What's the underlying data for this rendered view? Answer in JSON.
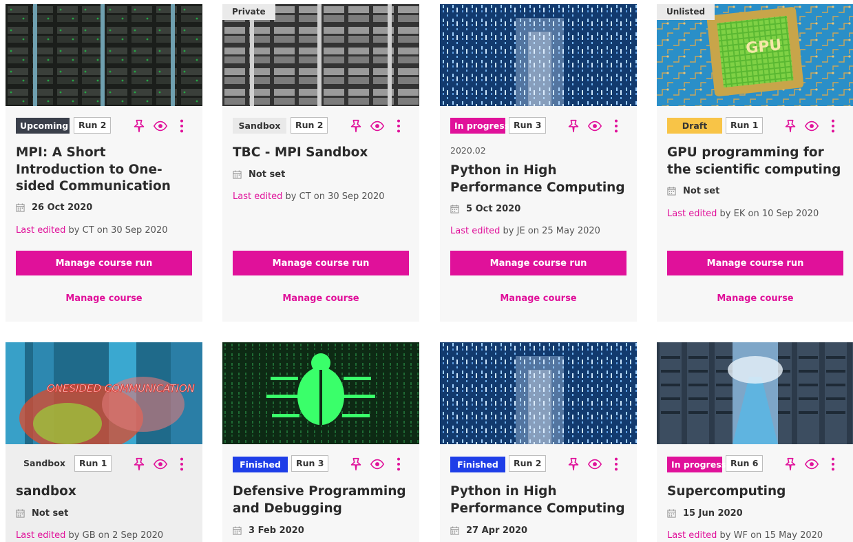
{
  "colors": {
    "accent": "#e0119a",
    "upcoming": "#3a3f4a",
    "draft": "#f8c447",
    "finished": "#1e3ee8",
    "sandbox": "#e9e9e9"
  },
  "icons": {
    "pin": "pin-icon",
    "preview": "eye-icon",
    "more": "more-vertical-icon",
    "date": "calendar-icon"
  },
  "actions": {
    "manage_run": "Manage course run",
    "manage_course": "Manage course"
  },
  "cards": [
    {
      "visibility": "",
      "status": "Upcoming",
      "run": "Run 2",
      "code": "",
      "title": "MPI: A Short Introduction to One-sided Communication",
      "date": "26 Oct 2020",
      "edited_link": "Last edited",
      "edited_rest": " by CT on 30 Sep 2020"
    },
    {
      "visibility": "Private",
      "status": "Sandbox",
      "run": "Run 2",
      "code": "",
      "title": "TBC - MPI Sandbox",
      "date": "Not set",
      "edited_link": "Last edited",
      "edited_rest": " by CT on 30 Sep 2020"
    },
    {
      "visibility": "",
      "status": "In progress",
      "run": "Run 3",
      "code": "2020.02",
      "title": "Python in High Performance Computing",
      "date": "5 Oct 2020",
      "edited_link": "Last edited",
      "edited_rest": " by JE on 25 May 2020"
    },
    {
      "visibility": "Unlisted",
      "status": "Draft",
      "run": "Run 1",
      "code": "",
      "title": "GPU programming for the scientific computing",
      "date": "Not set",
      "edited_link": "Last edited",
      "edited_rest": " by EK on 10 Sep 2020"
    },
    {
      "visibility": "",
      "status": "Sandbox",
      "run": "Run 1",
      "code": "",
      "title": "sandbox",
      "date": "Not set",
      "edited_link": "Last edited",
      "edited_rest": " by GB on 2 Sep 2020"
    },
    {
      "visibility": "",
      "status": "Finished",
      "run": "Run 3",
      "code": "",
      "title": "Defensive Programming and Debugging",
      "date": "3 Feb 2020",
      "edited_link": "",
      "edited_rest": ""
    },
    {
      "visibility": "",
      "status": "Finished",
      "run": "Run 2",
      "code": "",
      "title": "Python in High Performance Computing",
      "date": "27 Apr 2020",
      "edited_link": "",
      "edited_rest": ""
    },
    {
      "visibility": "",
      "status": "In progress",
      "run": "Run 6",
      "code": "",
      "title": "Supercomputing",
      "date": "15 Jun 2020",
      "edited_link": "Last edited",
      "edited_rest": " by WF on 15 May 2020"
    }
  ],
  "thumbnail_texts": {
    "gpu_chip": "GPU",
    "onesided": "ONESIDED COMMUNICATION"
  }
}
